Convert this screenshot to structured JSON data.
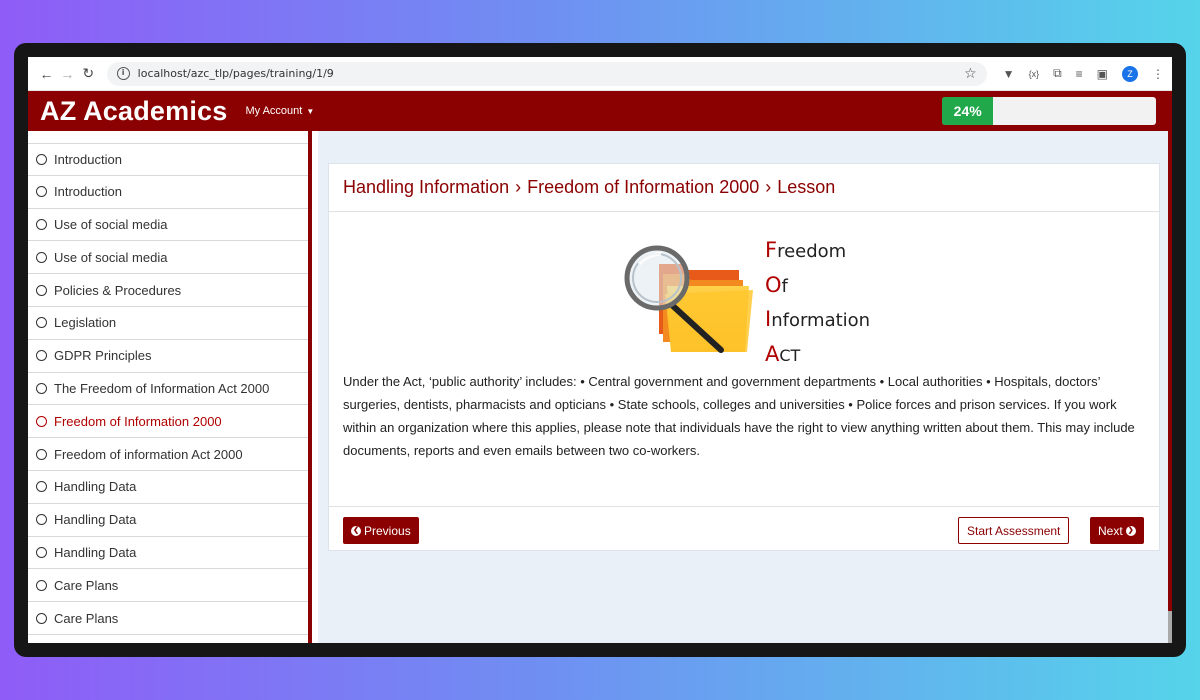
{
  "browser": {
    "url": "localhost/azc_tlp/pages/training/1/9",
    "profile_initial": "Z"
  },
  "header": {
    "brand": "AZ Academics",
    "account_label": "My Account",
    "progress": {
      "percent": 24,
      "label": "24%",
      "color": "#20a84a"
    },
    "color": "#8b0000"
  },
  "sidebar": {
    "items": [
      {
        "label": "Introduction",
        "active": false
      },
      {
        "label": "Introduction",
        "active": false
      },
      {
        "label": "Use of social media",
        "active": false
      },
      {
        "label": "Use of social media",
        "active": false
      },
      {
        "label": "Policies & Procedures",
        "active": false
      },
      {
        "label": "Legislation",
        "active": false
      },
      {
        "label": "GDPR Principles",
        "active": false
      },
      {
        "label": "The Freedom of Information Act 2000",
        "active": false
      },
      {
        "label": "Freedom of Information 2000",
        "active": true
      },
      {
        "label": "Freedom of information Act 2000",
        "active": false
      },
      {
        "label": "Handling Data",
        "active": false
      },
      {
        "label": "Handling Data",
        "active": false
      },
      {
        "label": "Handling Data",
        "active": false
      },
      {
        "label": "Care Plans",
        "active": false
      },
      {
        "label": "Care Plans",
        "active": false
      }
    ]
  },
  "lesson": {
    "breadcrumb": [
      "Handling Information",
      "Freedom of Information 2000",
      "Lesson"
    ],
    "breadcrumb_separator": "›",
    "image_title_lines": [
      {
        "cap": "F",
        "rest": "reedom"
      },
      {
        "cap": "O",
        "rest": "f"
      },
      {
        "cap": "I",
        "rest": "nformation"
      },
      {
        "cap": "A",
        "rest": "CT"
      }
    ],
    "body": "Under the Act, ‘public authority’ includes: • Central government and government departments • Local authorities • Hospitals, doctors’ surgeries, dentists, pharmacists and opticians • State schools, colleges and universities • Police forces and prison services. If you work within an organization where this applies, please note that individuals have the right to view anything written about them. This may include documents, reports and even emails between two co-workers.",
    "buttons": {
      "previous": "Previous",
      "start_assessment": "Start Assessment",
      "next": "Next"
    }
  }
}
